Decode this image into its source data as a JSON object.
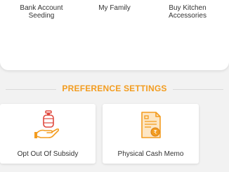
{
  "quick_actions": [
    {
      "label": "Bank Account Seeding"
    },
    {
      "label": "My Family"
    },
    {
      "label": "Buy Kitchen Accessories"
    }
  ],
  "preference_settings": {
    "title": "PREFERENCE SETTINGS",
    "cards": [
      {
        "label": "Opt Out Of Subsidy",
        "icon": "cylinder-in-hand-icon"
      },
      {
        "label": "Physical Cash Memo",
        "icon": "cash-memo-document-icon"
      }
    ]
  },
  "colors": {
    "accent": "#f39c1f",
    "accent_red": "#e0483e",
    "text": "#333333",
    "background": "#f2f2f2"
  }
}
